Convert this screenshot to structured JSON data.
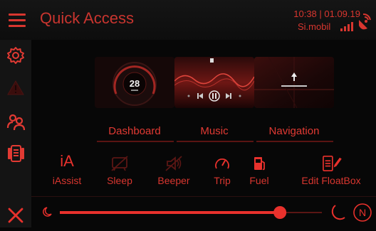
{
  "header": {
    "title": "Quick Access",
    "clock": "10:38 | 01.09.19",
    "carrier": "Si.mobil"
  },
  "sidebar": {
    "items": [
      {
        "icon": "gear-icon"
      },
      {
        "icon": "warning-icon"
      },
      {
        "icon": "users-icon"
      },
      {
        "icon": "phone-card-icon"
      },
      {
        "icon": "close-icon"
      }
    ]
  },
  "tiles": [
    {
      "label": "Dashboard",
      "gauge_value": "28"
    },
    {
      "label": "Music"
    },
    {
      "label": "Navigation"
    }
  ],
  "quick_actions": [
    {
      "label": "iAssist",
      "glyph": "iA"
    },
    {
      "label": "Sleep"
    },
    {
      "label": "Beeper"
    },
    {
      "label": "Trip"
    },
    {
      "label": "Fuel"
    },
    {
      "label": "Edit FloatBox"
    }
  ],
  "brightness": {
    "level": 0.84,
    "night_mode_badge": "N"
  },
  "colors": {
    "accent": "#e8312c",
    "background": "#070707",
    "panel": "#141414"
  }
}
